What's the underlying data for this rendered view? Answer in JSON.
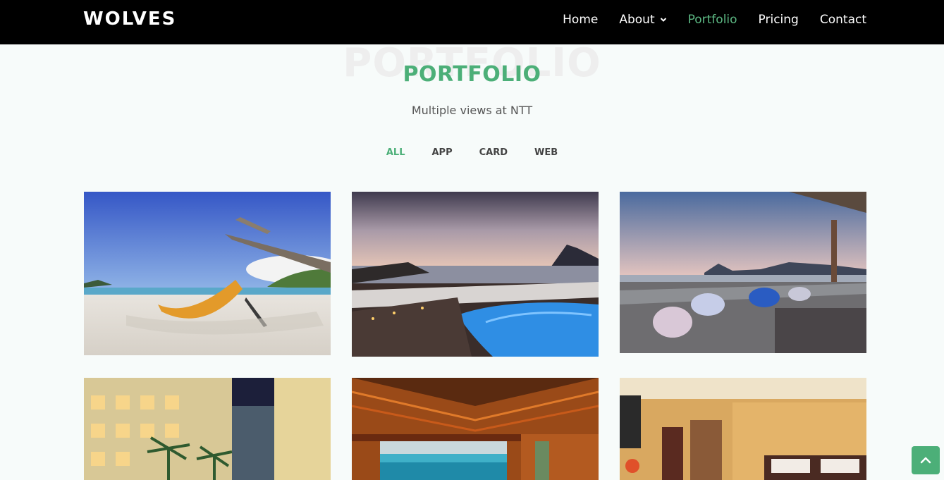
{
  "header": {
    "logo": "WOLVES",
    "nav": [
      {
        "label": "Home",
        "active": false
      },
      {
        "label": "About",
        "active": false,
        "has_dropdown": true
      },
      {
        "label": "Portfolio",
        "active": true
      },
      {
        "label": "Pricing",
        "active": false
      },
      {
        "label": "Contact",
        "active": false
      }
    ]
  },
  "section": {
    "bg_title": "PORTFOLIO",
    "title": "PORTFOLIO",
    "subtitle": "Multiple views at NTT"
  },
  "filters": [
    {
      "label": "ALL",
      "active": true
    },
    {
      "label": "APP",
      "active": false
    },
    {
      "label": "CARD",
      "active": false
    },
    {
      "label": "WEB",
      "active": false
    }
  ],
  "portfolio_items": [
    {
      "name": "beach-hammock-photo"
    },
    {
      "name": "pool-sunset-photo"
    },
    {
      "name": "rooftop-beanbags-photo"
    },
    {
      "name": "hotel-courtyard-photo"
    },
    {
      "name": "bamboo-pavilion-photo"
    },
    {
      "name": "hotel-room-photo"
    }
  ],
  "colors": {
    "accent": "#4caf78",
    "header_bg": "#000000",
    "page_bg": "#f7fbfa"
  },
  "icons": {
    "about_dropdown": "chevron-down-icon",
    "scroll_top": "arrow-up-icon"
  }
}
